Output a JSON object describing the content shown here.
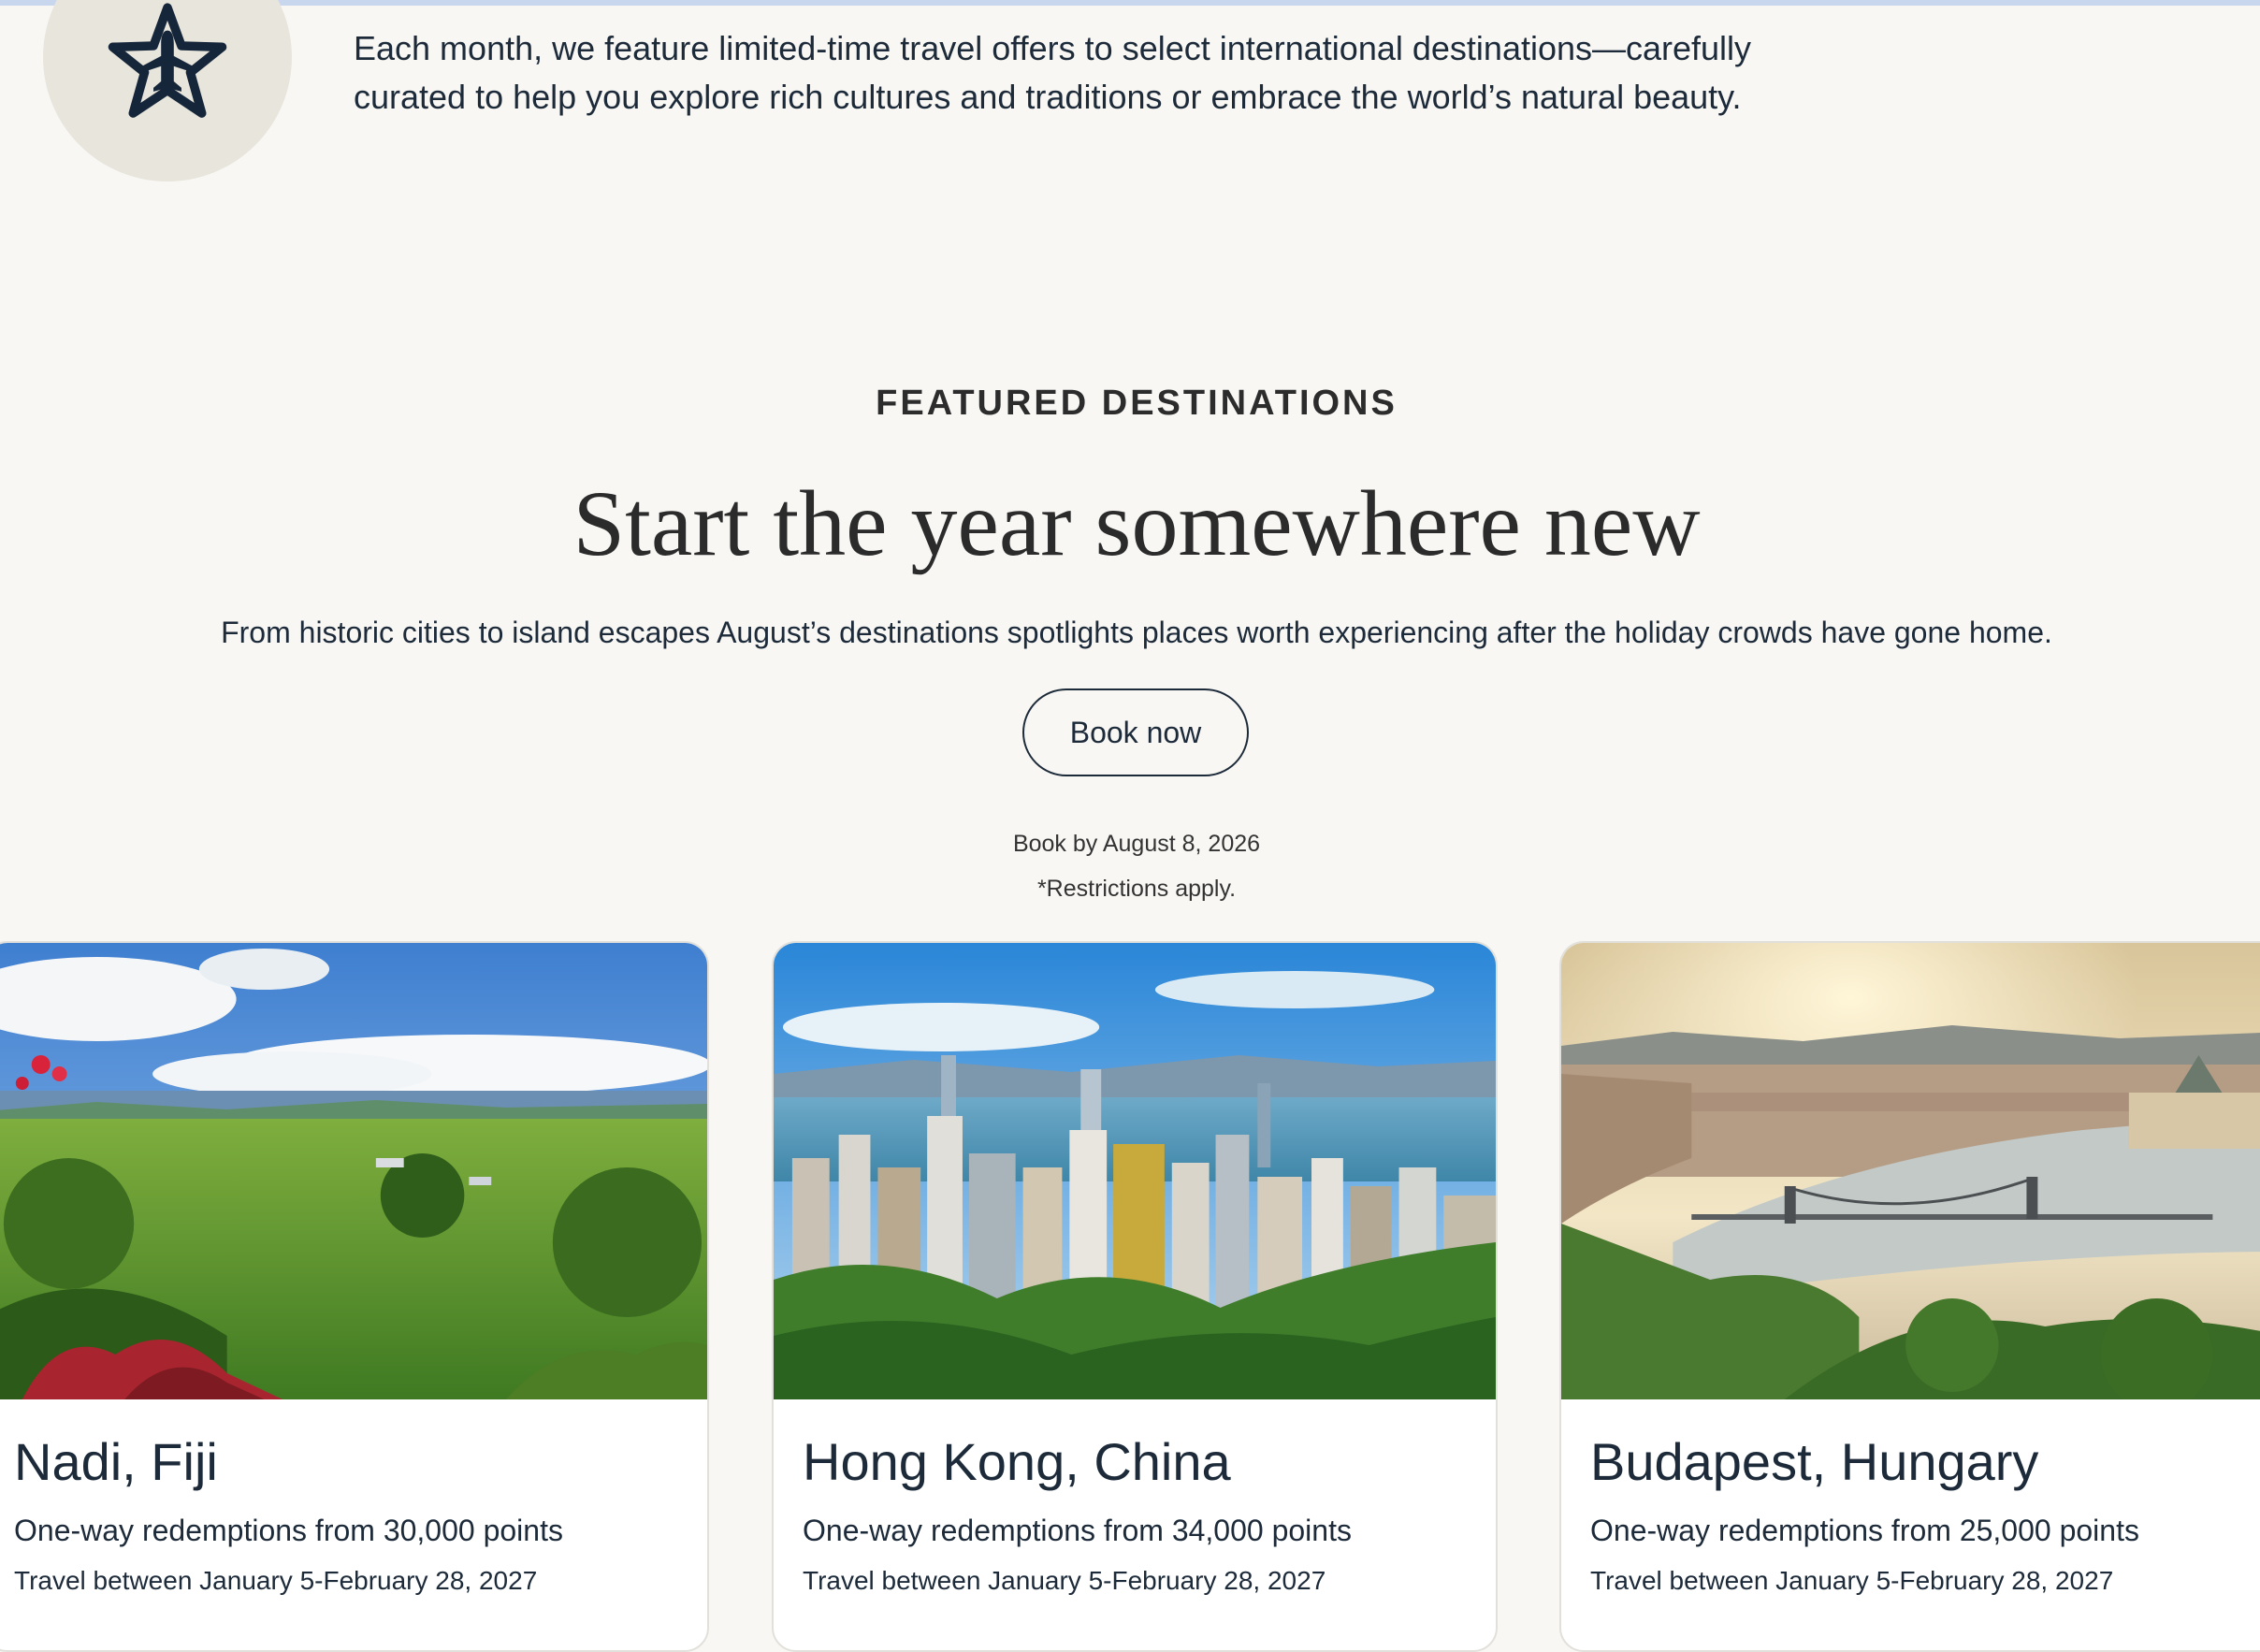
{
  "intro": {
    "icon": "plane-star-icon",
    "text": "Each month, we feature limited-time travel offers to select international destinations—carefully curated to help you explore rich cultures and traditions or embrace the world’s natural beauty."
  },
  "featured": {
    "eyebrow": "FEATURED DESTINATIONS",
    "headline": "Start the year somewhere new",
    "subtitle": "From historic cities to island escapes August’s destinations spotlights places worth experiencing after the holiday crowds have gone home.",
    "cta_label": "Book now",
    "deadline": "Book by August 8, 2026",
    "restrictions": "*Restrictions apply."
  },
  "destinations": [
    {
      "title": "Nadi, Fiji",
      "points": "One-way redemptions from 30,000 points",
      "dates": "Travel between January 5-February 28, 2027",
      "image": "fiji-landscape-photo"
    },
    {
      "title": "Hong Kong, China",
      "points": "One-way redemptions from 34,000 points",
      "dates": "Travel between January 5-February 28, 2027",
      "image": "hong-kong-skyline-photo"
    },
    {
      "title": "Budapest, Hungary",
      "points": "One-way redemptions from 25,000 points",
      "dates": "Travel between January 5-February 28, 2027",
      "image": "budapest-danube-photo"
    }
  ],
  "colors": {
    "background": "#f8f7f4",
    "text": "#1c2a39",
    "badge": "#e8e5dc",
    "card_border": "#e2e0da"
  }
}
